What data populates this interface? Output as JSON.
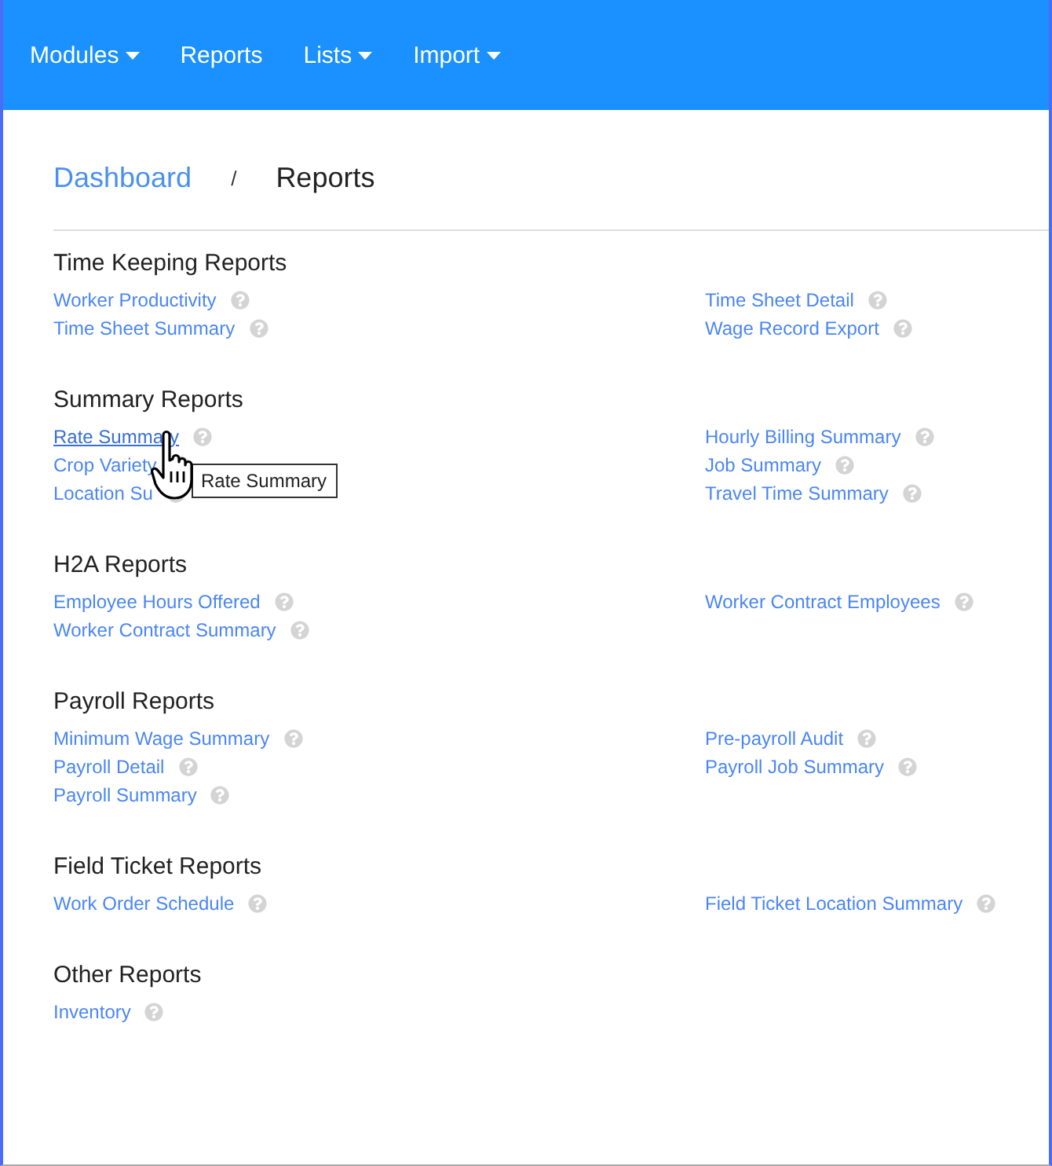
{
  "nav": [
    {
      "label": "Modules",
      "dropdown": true
    },
    {
      "label": "Reports",
      "dropdown": false
    },
    {
      "label": "Lists",
      "dropdown": true
    },
    {
      "label": "Import",
      "dropdown": true
    }
  ],
  "breadcrumb": [
    {
      "label": "Dashboard",
      "kind": "link"
    },
    {
      "label": "/",
      "kind": "separator"
    },
    {
      "label": "Reports",
      "kind": "current"
    }
  ],
  "tooltip": {
    "text": "Rate Summary"
  },
  "sections": [
    {
      "title": "Time Keeping Reports",
      "left": [
        {
          "label": "Worker Productivity",
          "hovered": false
        },
        {
          "label": "Time Sheet Summary",
          "hovered": false
        }
      ],
      "right": [
        {
          "label": "Time Sheet Detail",
          "hovered": false
        },
        {
          "label": "Wage Record Export",
          "hovered": false
        }
      ]
    },
    {
      "title": "Summary Reports",
      "left": [
        {
          "label": "Rate Summary",
          "hovered": true
        },
        {
          "label": "Crop Variety",
          "hovered": false
        },
        {
          "label": "Location Su",
          "hovered": false
        }
      ],
      "right": [
        {
          "label": "Hourly Billing Summary",
          "hovered": false
        },
        {
          "label": "Job Summary",
          "hovered": false
        },
        {
          "label": "Travel Time Summary",
          "hovered": false
        }
      ]
    },
    {
      "title": "H2A Reports",
      "left": [
        {
          "label": "Employee Hours Offered",
          "hovered": false
        },
        {
          "label": "Worker Contract Summary",
          "hovered": false
        }
      ],
      "right": [
        {
          "label": "Worker Contract Employees",
          "hovered": false
        }
      ]
    },
    {
      "title": "Payroll Reports",
      "left": [
        {
          "label": "Minimum Wage Summary",
          "hovered": false
        },
        {
          "label": "Payroll Detail",
          "hovered": false
        },
        {
          "label": "Payroll Summary",
          "hovered": false
        }
      ],
      "right": [
        {
          "label": "Pre-payroll Audit",
          "hovered": false
        },
        {
          "label": "Payroll Job Summary",
          "hovered": false
        }
      ]
    },
    {
      "title": "Field Ticket Reports",
      "left": [
        {
          "label": "Work Order Schedule",
          "hovered": false
        }
      ],
      "right": [
        {
          "label": "Field Ticket Location Summary",
          "hovered": false
        }
      ]
    },
    {
      "title": "Other Reports",
      "left": [
        {
          "label": "Inventory",
          "hovered": false
        }
      ]
    }
  ]
}
